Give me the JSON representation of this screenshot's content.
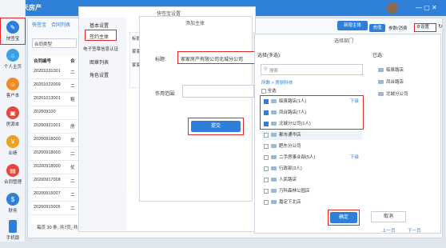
{
  "app": {
    "brand": "天天房产",
    "tab_settings": "快签宝设置",
    "tab_add_subject": "添加主体",
    "tab_select_dept": "选择部门"
  },
  "rail": [
    "快签宝",
    "个人主页",
    "客户本",
    "房源本",
    "业绩",
    "合同管理",
    "财务",
    "手机版"
  ],
  "topbar": {
    "new_subject": "新增主体",
    "recharge": "充值",
    "participate": "参数/消费",
    "settings": "设置"
  },
  "filter": {
    "tab": "快签宝",
    "contract_list": "合同列表",
    "contract_type": "合同类型"
  },
  "table": {
    "header": [
      "合同编号",
      "合"
    ],
    "rows": [
      [
        "20201031001",
        "二"
      ],
      [
        "20201022009",
        "二"
      ],
      [
        "20201013001",
        "租"
      ],
      [
        "202009100",
        ""
      ],
      [
        "20200921001",
        "房"
      ],
      [
        "20200918000",
        "优"
      ],
      [
        "20200918000",
        "二"
      ],
      [
        "20200918000",
        "优"
      ],
      [
        "20200917008",
        "二"
      ],
      [
        "20200915007",
        "二"
      ],
      [
        "20200915005",
        "二"
      ]
    ]
  },
  "pagination": {
    "text": "每页 30 条, 共7页, 共计205条, 当前第 1 页",
    "per_page": "30",
    "page": "1",
    "go": "跳转"
  },
  "settings_menu": [
    "基本设置",
    "签约主体",
    "电子签章信息认证",
    "图章列表",
    "角色设置"
  ],
  "add_subject": {
    "title": "添加主体",
    "col_label_top": "标题",
    "row_a": "家家",
    "row_b": "家家",
    "label_title": "标题:",
    "title_value": "家家房产有限公司北城分公司",
    "label_scope": "作用范围:",
    "submit": "提交"
  },
  "select_dept": {
    "title": "选择部门",
    "left_label": "选择(多选):",
    "right_label": "已选:",
    "search_placeholder": "搜索",
    "breadcrumb": "所数 > 房朋科技",
    "select_all": "全选",
    "items": [
      {
        "label": "临泉路店(1人)",
        "checked": true,
        "sub": "下级"
      },
      {
        "label": "凤台路店(7人)",
        "checked": true,
        "sub": ""
      },
      {
        "label": "北城分公司(1人)",
        "checked": true,
        "sub": ""
      },
      {
        "label": "都市通华店",
        "checked": false,
        "sub": ""
      },
      {
        "label": "肥东分公司",
        "checked": false,
        "sub": ""
      },
      {
        "label": "二手房事业部(5人)",
        "checked": false,
        "sub": "下级"
      },
      {
        "label": "行政部(3人)",
        "checked": false,
        "sub": ""
      },
      {
        "label": "人民路店",
        "checked": false,
        "sub": ""
      },
      {
        "label": "万科森林公园店",
        "checked": false,
        "sub": ""
      },
      {
        "label": "嘉定下北店",
        "checked": false,
        "sub": ""
      }
    ],
    "selected": [
      "临泉路店",
      "凤台路店",
      "北城分公司"
    ],
    "confirm": "确定",
    "cancel": "取消",
    "prev": "上一页",
    "next": "下一页"
  },
  "colors": {
    "accent": "#2e7fd9",
    "highlight": "#e22a2a"
  }
}
